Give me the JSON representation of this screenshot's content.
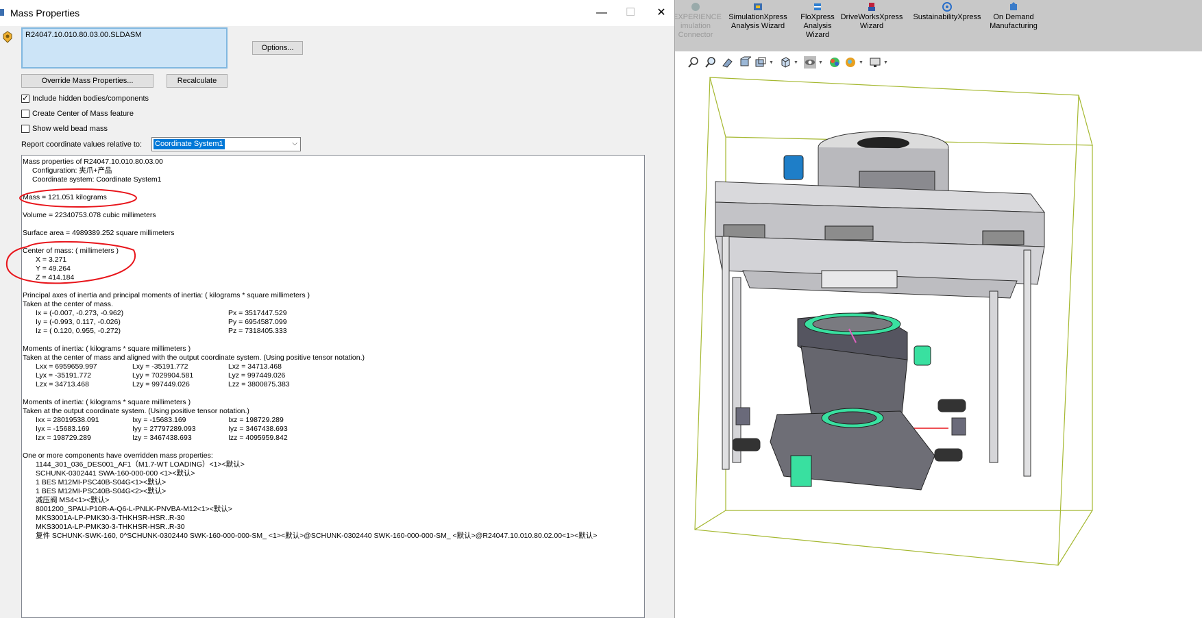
{
  "dialog": {
    "title": "Mass Properties",
    "selection_item": "R24047.10.010.80.03.00.SLDASM",
    "options_label": "Options...",
    "override_label": "Override Mass Properties...",
    "recalculate_label": "Recalculate",
    "checkboxes": [
      {
        "label": "Include hidden bodies/components",
        "checked": true
      },
      {
        "label": "Create Center of Mass feature",
        "checked": false
      },
      {
        "label": "Show weld bead mass",
        "checked": false
      }
    ],
    "report_label": "Report coordinate values relative to:",
    "coordinate_system": "Coordinate System1",
    "minimize_glyph": "—",
    "maximize_glyph": "☐",
    "close_glyph": "✕",
    "check_glyph": "✓",
    "combo_arrow": "⌵"
  },
  "results": {
    "header": "Mass properties of R24047.10.010.80.03.00",
    "configuration": "Configuration: 夹爪+产品",
    "coord_system": "Coordinate system: Coordinate System1",
    "mass": "Mass = 121.051 kilograms",
    "volume": "Volume = 22340753.078 cubic millimeters",
    "surface_area": "Surface area = 4989389.252  square millimeters",
    "com_header": "Center of mass: ( millimeters )",
    "com_x": "X = 3.271",
    "com_y": "Y = 49.264",
    "com_z": "Z = 414.184",
    "principal_header": "Principal axes of inertia and principal moments of inertia: ( kilograms *  square millimeters )",
    "taken_com": "Taken at the center of mass.",
    "ix": "Ix = (-0.007, -0.273, -0.962)",
    "iy": "Iy = (-0.993,  0.117, -0.026)",
    "iz": "Iz = ( 0.120,  0.955, -0.272)",
    "px": "Px = 3517447.529",
    "py": "Py = 6954587.099",
    "pz": "Pz = 7318405.333",
    "moi1_header": "Moments of inertia: ( kilograms *  square millimeters )",
    "moi1_taken": "Taken at the center of mass and aligned with the output coordinate system. (Using positive tensor notation.)",
    "lxx": "Lxx = 6959659.997",
    "lxy": "Lxy = -35191.772",
    "lxz": "Lxz = 34713.468",
    "lyx": "Lyx = -35191.772",
    "lyy": "Lyy = 7029904.581",
    "lyz": "Lyz = 997449.026",
    "lzx": "Lzx = 34713.468",
    "lzy": "Lzy = 997449.026",
    "lzz": "Lzz = 3800875.383",
    "moi2_header": "Moments of inertia: ( kilograms *  square millimeters )",
    "moi2_taken": "Taken at the output coordinate system. (Using positive tensor notation.)",
    "ixx": "Ixx = 28019538.091",
    "ixy": "Ixy = -15683.169",
    "ixz": "Ixz = 198729.289",
    "iyx": "Iyx = -15683.169",
    "iyy": "Iyy = 27797289.093",
    "iyz": "Iyz = 3467438.693",
    "izx": "Izx = 198729.289",
    "izy": "Izy = 3467438.693",
    "izz": "Izz = 4095959.842",
    "override_header": "One or more components have overridden mass properties:",
    "override_items": [
      "1144_301_036_DES001_AF1（M1.7-WT LOADING）<1><默认>",
      "SCHUNK-0302441 SWA-160-000-000 <1><默认>",
      "1  BES M12MI-PSC40B-S04G<1><默认>",
      "1  BES M12MI-PSC40B-S04G<2><默认>",
      "减压阀 MS4<1><默认>",
      "8001200_SPAU-P10R-A-Q6-L-PNLK-PNVBA-M12<1><默认>",
      "MKS3001A-LP-PMK30-3-THKHSR-HSR..R-30",
      "MKS3001A-LP-PMK30-3-THKHSR-HSR..R-30",
      "复件 SCHUNK-SWK-160, 0^SCHUNK-0302440 SWK-160-000-000-SM_ <1><默认>@SCHUNK-0302440 SWK-160-000-000-SM_ <默认>@R24047.10.010.80.02.00<1><默认>"
    ]
  },
  "ribbon": {
    "items": [
      {
        "label_l1": "EXPERIENCE",
        "label_l2": "imulation",
        "label_l3": "Connector",
        "icon": "cloud-sim-icon"
      },
      {
        "label_l1": "SimulationXpress",
        "label_l2": "Analysis Wizard",
        "label_l3": "",
        "icon": "simulation-icon"
      },
      {
        "label_l1": "FloXpress",
        "label_l2": "Analysis",
        "label_l3": "Wizard",
        "icon": "flow-icon"
      },
      {
        "label_l1": "DriveWorksXpress",
        "label_l2": "Wizard",
        "label_l3": "",
        "icon": "driveworks-icon"
      },
      {
        "label_l1": "SustainabilityXpress",
        "label_l2": "",
        "label_l3": "",
        "icon": "sustainability-icon"
      },
      {
        "label_l1": "On Demand",
        "label_l2": "Manufacturing",
        "label_l3": "",
        "icon": "manufacturing-icon"
      }
    ]
  },
  "colors": {
    "annotation": "#e8151b",
    "bounding_box": "#a5b830",
    "accent_green": "#39e0a0",
    "selection_bg": "#cce4f7",
    "highlight": "#0078d7"
  }
}
